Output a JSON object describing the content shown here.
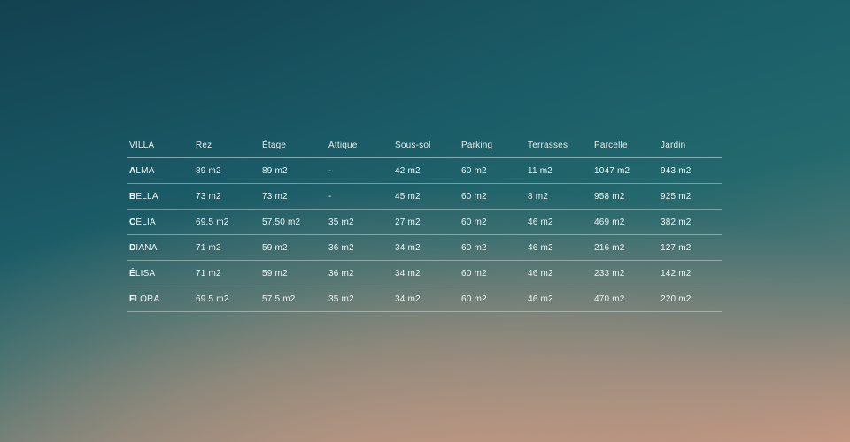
{
  "table": {
    "headers": [
      "VILLA",
      "Rez",
      "Étage",
      "Attique",
      "Sous-sol",
      "Parking",
      "Terrasses",
      "Parcelle",
      "Jardin"
    ],
    "rows": [
      {
        "initial": "A",
        "rest": "LMA",
        "cells": [
          "89 m2",
          "89 m2",
          "-",
          "42 m2",
          "60 m2",
          "11 m2",
          "1047 m2",
          "943 m2"
        ]
      },
      {
        "initial": "B",
        "rest": "ELLA",
        "cells": [
          "73 m2",
          "73 m2",
          "-",
          "45 m2",
          "60 m2",
          "8 m2",
          "958 m2",
          "925 m2"
        ]
      },
      {
        "initial": "C",
        "rest": "ÉLIA",
        "cells": [
          "69.5 m2",
          "57.50 m2",
          "35 m2",
          "27 m2",
          "60 m2",
          "46 m2",
          "469 m2",
          "382 m2"
        ]
      },
      {
        "initial": "D",
        "rest": "IANA",
        "cells": [
          "71 m2",
          "59 m2",
          "36 m2",
          "34 m2",
          "60 m2",
          "46 m2",
          "216 m2",
          "127 m2"
        ]
      },
      {
        "initial": "É",
        "rest": "LISA",
        "cells": [
          "71 m2",
          "59 m2",
          "36 m2",
          "34 m2",
          "60 m2",
          "46 m2",
          "233 m2",
          "142 m2"
        ]
      },
      {
        "initial": "F",
        "rest": "LORA",
        "cells": [
          "69.5 m2",
          "57.5 m2",
          "35 m2",
          "34 m2",
          "60 m2",
          "46 m2",
          "470 m2",
          "220 m2"
        ]
      }
    ]
  }
}
